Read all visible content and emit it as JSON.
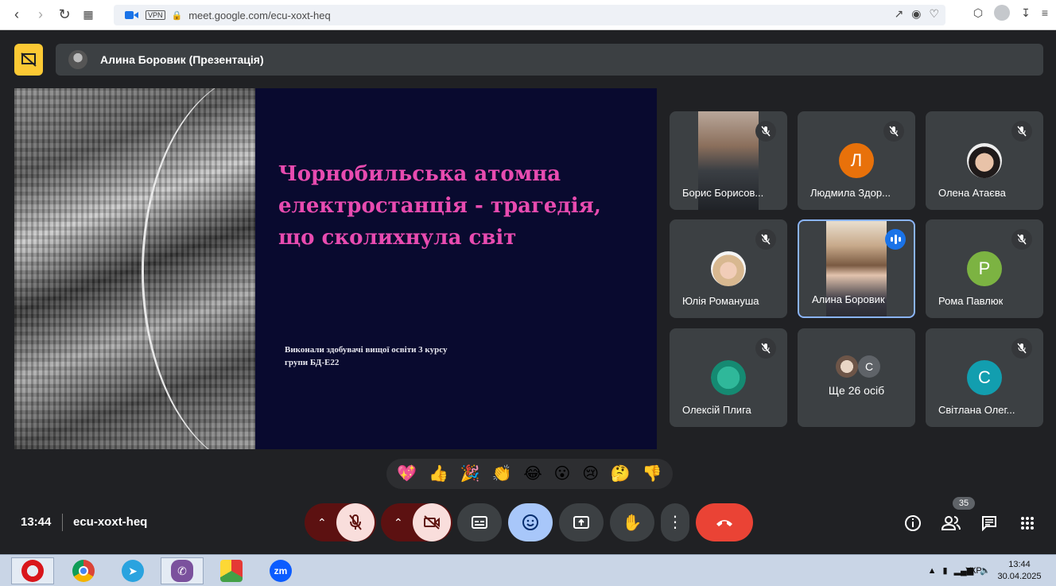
{
  "browser": {
    "url": "meet.google.com/ecu-xoxt-heq",
    "vpn_label": "VPN"
  },
  "presenter": {
    "name": "Алина Боровик (Презентація)"
  },
  "slide": {
    "title": "Чорнобильська атомна електростанція - трагедія, що сколихнула світ",
    "subtitle_line1": "Виконали здобувачі вищої освіти 3 курсу",
    "subtitle_line2": "групи БД-Е22"
  },
  "participants": [
    {
      "name": "Борис Борисов...",
      "type": "video",
      "muted": true
    },
    {
      "name": "Людмила Здор...",
      "type": "letter",
      "letter": "Л",
      "color": "#e8710a",
      "muted": true
    },
    {
      "name": "Олена Атаєва",
      "type": "photo",
      "muted": true
    },
    {
      "name": "Юлія Романуша",
      "type": "photo",
      "muted": true
    },
    {
      "name": "Алина Боровик",
      "type": "video",
      "speaking": true
    },
    {
      "name": "Рома Павлюк",
      "type": "letter",
      "letter": "Р",
      "color": "#7cb342",
      "muted": true
    },
    {
      "name": "Олексій Плига",
      "type": "photo",
      "muted": true
    },
    {
      "name": "Ще 26 осіб",
      "type": "more",
      "letter": "С"
    },
    {
      "name": "Світлана Олег...",
      "type": "letter",
      "letter": "С",
      "color": "#129eaf",
      "muted": true
    }
  ],
  "reactions": [
    "💖",
    "👍",
    "🎉",
    "👏",
    "😂",
    "😮",
    "😢",
    "🤔",
    "👎"
  ],
  "meeting": {
    "time": "13:44",
    "code": "ecu-xoxt-heq",
    "participant_count": "35"
  },
  "taskbar": {
    "language": "УКР",
    "time": "13:44",
    "date": "30.04.2025",
    "zoom_label": "zm"
  }
}
